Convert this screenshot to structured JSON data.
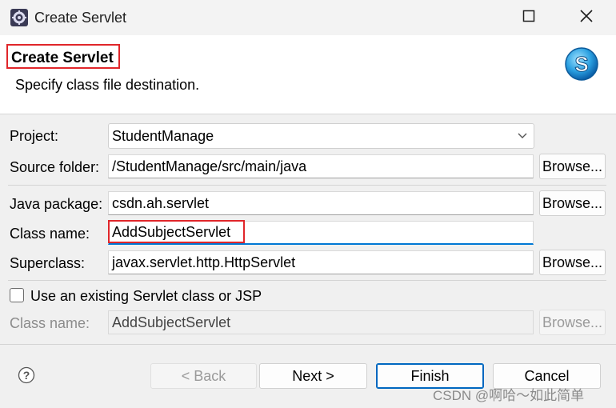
{
  "window": {
    "title": "Create Servlet",
    "icon": "eclipse-gear-icon",
    "controls": [
      "minimize-icon",
      "maximize-icon",
      "close-icon"
    ]
  },
  "banner": {
    "title": "Create Servlet",
    "description": "Specify class file destination.",
    "logo": "servlet-s-logo-icon"
  },
  "form": {
    "project": {
      "label": "Project:",
      "value": "StudentManage"
    },
    "source_folder": {
      "label": "Source folder:",
      "value": "/StudentManage/src/main/java",
      "button": "Browse..."
    },
    "java_package": {
      "label": "Java package:",
      "value": "csdn.ah.servlet",
      "button": "Browse..."
    },
    "class_name": {
      "label": "Class name:",
      "value": "AddSubjectServlet"
    },
    "superclass": {
      "label": "Superclass:",
      "value": "javax.servlet.http.HttpServlet",
      "button": "Browse..."
    },
    "existing": {
      "label": "Use an existing Servlet class or JSP",
      "checked": false
    },
    "existing_class": {
      "label": "Class name:",
      "value": "AddSubjectServlet",
      "button": "Browse..."
    }
  },
  "footer": {
    "help_icon": "help-question-icon",
    "back": "< Back",
    "next": "Next >",
    "finish": "Finish",
    "cancel": "Cancel"
  },
  "watermark": "CSDN @啊哈～如此简单"
}
